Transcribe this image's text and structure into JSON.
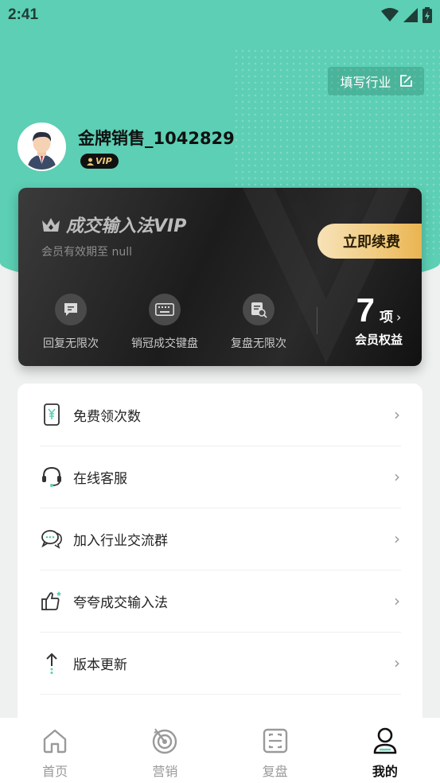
{
  "status_bar": {
    "time": "2:41"
  },
  "header": {
    "industry_button_label": "填写行业"
  },
  "profile": {
    "username": "金牌销售_1042829",
    "badge": "VIP"
  },
  "vip_card": {
    "title": "成交输入法VIP",
    "expire_text": "会员有效期至 null",
    "renew_label": "立即续费",
    "perks": [
      {
        "label": "回复无限次",
        "icon": "message-icon"
      },
      {
        "label": "销冠成交键盘",
        "icon": "keyboard-icon"
      },
      {
        "label": "复盘无限次",
        "icon": "search-doc-icon"
      }
    ],
    "perk_count": "7",
    "perk_unit": "项",
    "perk_sub": "会员权益"
  },
  "menu": {
    "items": [
      {
        "label": "免费领次数",
        "icon": "coupon-phone-icon"
      },
      {
        "label": "在线客服",
        "icon": "headset-icon"
      },
      {
        "label": "加入行业交流群",
        "icon": "chat-bubbles-icon"
      },
      {
        "label": "夸夸成交输入法",
        "icon": "thumbs-up-icon"
      },
      {
        "label": "版本更新",
        "icon": "arrow-up-icon"
      }
    ]
  },
  "tabs": [
    {
      "label": "首页",
      "icon": "home-icon"
    },
    {
      "label": "营销",
      "icon": "target-icon"
    },
    {
      "label": "复盘",
      "icon": "scan-icon"
    },
    {
      "label": "我的",
      "icon": "user-icon"
    }
  ],
  "colors": {
    "accent": "#5ccfb4",
    "gold": "#f0c97a",
    "card_dark": "#1c1c1c"
  }
}
